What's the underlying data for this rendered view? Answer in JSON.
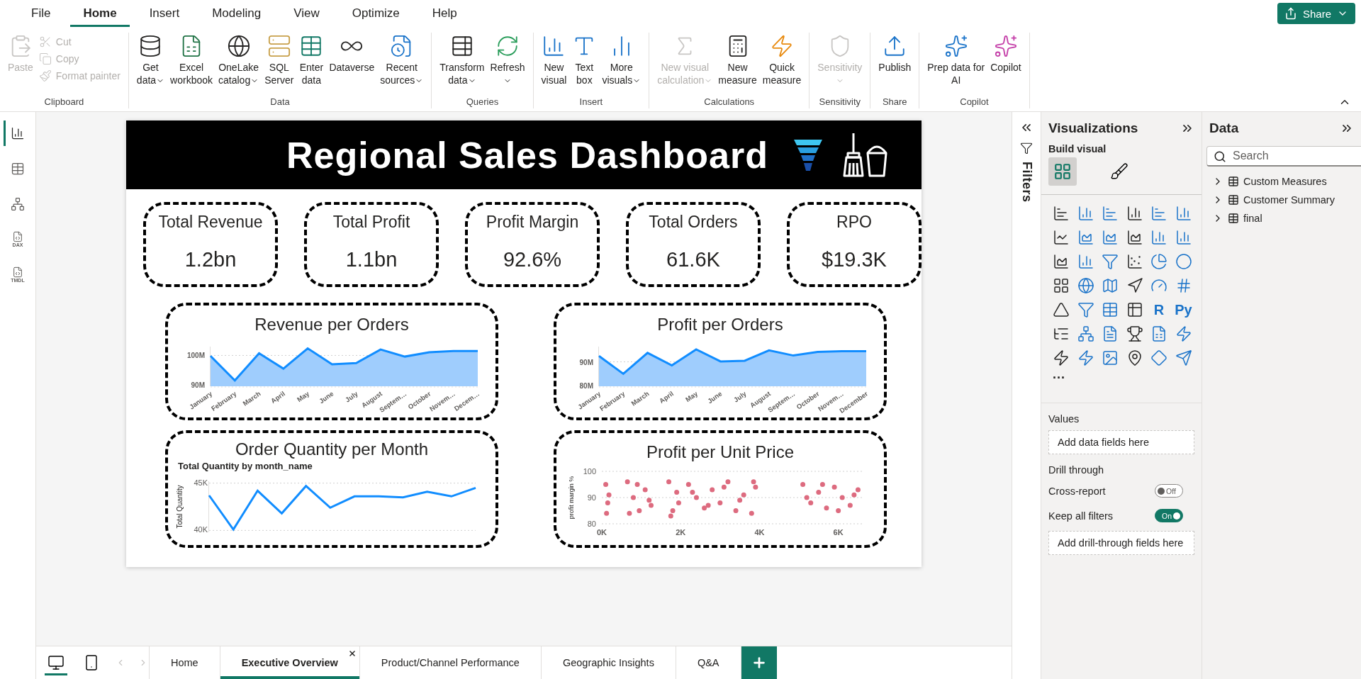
{
  "menu": [
    {
      "label": "File",
      "selected": false
    },
    {
      "label": "Home",
      "selected": true
    },
    {
      "label": "Insert",
      "selected": false
    },
    {
      "label": "Modeling",
      "selected": false
    },
    {
      "label": "View",
      "selected": false
    },
    {
      "label": "Optimize",
      "selected": false
    },
    {
      "label": "Help",
      "selected": false
    }
  ],
  "share_button": {
    "label": "Share"
  },
  "ribbon": [
    {
      "group": "Clipboard",
      "buttons": [
        {
          "label": "Paste",
          "kind": "large",
          "disabled": true,
          "dropdown": false
        },
        {
          "label": "Cut",
          "kind": "small",
          "disabled": true,
          "dropdown": false
        },
        {
          "label": "Copy",
          "kind": "small",
          "disabled": true,
          "dropdown": false
        },
        {
          "label": "Format painter",
          "kind": "small",
          "disabled": true,
          "dropdown": false
        }
      ]
    },
    {
      "group": "Data",
      "buttons": [
        {
          "label": "Get\ndata",
          "kind": "large",
          "disabled": false,
          "dropdown": true
        },
        {
          "label": "Excel\nworkbook",
          "kind": "large",
          "disabled": false,
          "dropdown": false
        },
        {
          "label": "OneLake\ncatalog",
          "kind": "large",
          "disabled": false,
          "dropdown": true
        },
        {
          "label": "SQL\nServer",
          "kind": "large",
          "disabled": false,
          "dropdown": false
        },
        {
          "label": "Enter\ndata",
          "kind": "large",
          "disabled": false,
          "dropdown": false
        },
        {
          "label": "Dataverse",
          "kind": "large",
          "disabled": false,
          "dropdown": false
        },
        {
          "label": "Recent\nsources",
          "kind": "large",
          "disabled": false,
          "dropdown": true
        }
      ]
    },
    {
      "group": "Queries",
      "buttons": [
        {
          "label": "Transform\ndata",
          "kind": "large",
          "disabled": false,
          "dropdown": true
        },
        {
          "label": "Refresh",
          "kind": "large",
          "disabled": false,
          "dropdown": true
        }
      ]
    },
    {
      "group": "Insert",
      "buttons": [
        {
          "label": "New\nvisual",
          "kind": "large",
          "disabled": false,
          "dropdown": false
        },
        {
          "label": "Text\nbox",
          "kind": "large",
          "disabled": false,
          "dropdown": false
        },
        {
          "label": "More\nvisuals",
          "kind": "large",
          "disabled": false,
          "dropdown": true
        }
      ]
    },
    {
      "group": "Calculations",
      "buttons": [
        {
          "label": "New visual\ncalculation",
          "kind": "large",
          "disabled": true,
          "dropdown": true
        },
        {
          "label": "New\nmeasure",
          "kind": "large",
          "disabled": false,
          "dropdown": false
        },
        {
          "label": "Quick\nmeasure",
          "kind": "large",
          "disabled": false,
          "dropdown": false
        }
      ]
    },
    {
      "group": "Sensitivity",
      "buttons": [
        {
          "label": "Sensitivity",
          "kind": "large",
          "disabled": true,
          "dropdown": true
        }
      ]
    },
    {
      "group": "Share",
      "buttons": [
        {
          "label": "Publish",
          "kind": "large",
          "disabled": false,
          "dropdown": false
        }
      ]
    },
    {
      "group": "Copilot",
      "buttons": [
        {
          "label": "Prep data for\nAI",
          "kind": "large",
          "disabled": false,
          "dropdown": false
        },
        {
          "label": "Copilot",
          "kind": "large",
          "disabled": false,
          "dropdown": false
        }
      ]
    }
  ],
  "rail": [
    {
      "selected": true
    },
    {
      "selected": false
    },
    {
      "selected": false
    },
    {
      "label": "DAX",
      "selected": false
    },
    {
      "label": "TMDL",
      "selected": false
    }
  ],
  "report": {
    "title": "Regional Sales Dashboard",
    "kpis": [
      {
        "label": "Total Revenue",
        "value": "1.2bn"
      },
      {
        "label": "Total Profit",
        "value": "1.1bn"
      },
      {
        "label": "Profit Margin",
        "value": "92.6%"
      },
      {
        "label": "Total Orders",
        "value": "61.6K"
      },
      {
        "label": "RPO",
        "value": "$19.3K"
      }
    ],
    "charts": [
      {
        "title": "Revenue per Orders",
        "chart_data": {
          "type": "area",
          "categories": [
            "January",
            "February",
            "March",
            "April",
            "May",
            "June",
            "July",
            "August",
            "Septem…",
            "October",
            "Novem…",
            "Decem…"
          ],
          "series": [
            {
              "color": "#118dff",
              "values": [
                99.8,
                91.5,
                100.7,
                95.5,
                102.4,
                97.0,
                97.4,
                102.0,
                99.6,
                101.1,
                101.5,
                101.5
              ]
            }
          ],
          "ylim": [
            89.5,
            103
          ],
          "yticks": [
            {
              "value": 90,
              "label": "90M"
            },
            {
              "value": 100,
              "label": "100M"
            }
          ]
        }
      },
      {
        "title": "Profit per Orders",
        "chart_data": {
          "type": "area",
          "categories": [
            "January",
            "February",
            "March",
            "April",
            "May",
            "June",
            "July",
            "August",
            "Septem…",
            "October",
            "Novem…",
            "December"
          ],
          "series": [
            {
              "color": "#118dff",
              "values": [
                92.5,
                84.9,
                93.8,
                88.5,
                95.3,
                90.2,
                90.5,
                94.9,
                92.7,
                94.2,
                94.5,
                94.5
              ]
            }
          ],
          "ylim": [
            79.6,
            96.5
          ],
          "yticks": [
            {
              "value": 80,
              "label": "80M"
            },
            {
              "value": 90,
              "label": "90M"
            }
          ]
        }
      },
      {
        "title": "Order Quantity per Month",
        "chart_data": {
          "type": "line",
          "title": "Total Quantity by month_name",
          "ylabel": "Total Quantity",
          "series": [
            {
              "color": "#118dff",
              "values": [
                43.7,
                40.1,
                44.2,
                41.8,
                44.7,
                42.4,
                43.6,
                43.6,
                43.5,
                44.1,
                43.6,
                44.5
              ]
            }
          ],
          "ylim": [
            39.8,
            45.2
          ],
          "yticks": [
            {
              "value": 40,
              "label": "40K"
            },
            {
              "value": 45,
              "label": "45K"
            }
          ]
        }
      },
      {
        "title": "Profit per Unit Price",
        "chart_data": {
          "type": "scatter",
          "ylabel": "profit margin %",
          "x": [
            0.1,
            0.15,
            0.12,
            0.18,
            0.65,
            0.8,
            0.95,
            1.1,
            1.25,
            0.7,
            0.9,
            1.2,
            1.7,
            1.8,
            1.9,
            1.95,
            1.75,
            2.2,
            2.4,
            2.6,
            2.8,
            3.0,
            3.2,
            3.4,
            3.6,
            3.8,
            3.9,
            2.3,
            2.7,
            3.1,
            3.5,
            3.85,
            5.1,
            5.3,
            5.5,
            5.7,
            5.9,
            6.1,
            6.3,
            6.5,
            5.2,
            5.6,
            6.0,
            6.4
          ],
          "series": [
            {
              "color": "#dd6b7f",
              "values": [
                95,
                88,
                84,
                91,
                96,
                90,
                85,
                93,
                87,
                84,
                95,
                89,
                96,
                85,
                92,
                88,
                83,
                95,
                90,
                86,
                93,
                88,
                96,
                85,
                91,
                84,
                94,
                92,
                87,
                94,
                89,
                96,
                95,
                88,
                92,
                86,
                94,
                90,
                87,
                93,
                90,
                95,
                85,
                91
              ]
            }
          ],
          "xlim": [
            0,
            6.6
          ],
          "ylim": [
            80,
            100
          ],
          "xticks": [
            {
              "value": 0,
              "label": "0K"
            },
            {
              "value": 2,
              "label": "2K"
            },
            {
              "value": 4,
              "label": "4K"
            },
            {
              "value": 6,
              "label": "6K"
            }
          ],
          "yticks": [
            80,
            90,
            100
          ]
        }
      }
    ]
  },
  "page_tabs": {
    "views": [
      {
        "selected": true
      },
      {
        "selected": false
      }
    ],
    "tabs": [
      {
        "label": "Home",
        "selected": false
      },
      {
        "label": "Executive Overview",
        "selected": true
      },
      {
        "label": "Product/Channel Performance",
        "selected": false
      },
      {
        "label": "Geographic Insights",
        "selected": false
      },
      {
        "label": "Q&A",
        "selected": false
      }
    ]
  },
  "filters_pane": {
    "title": "Filters"
  },
  "visualizations": {
    "title": "Visualizations",
    "subtitle": "Build visual",
    "modes": [
      {
        "selected": true
      },
      {
        "selected": false
      }
    ],
    "visuals": [
      {
        "kind": "icon"
      },
      {
        "kind": "icon"
      },
      {
        "kind": "icon"
      },
      {
        "kind": "icon"
      },
      {
        "kind": "icon"
      },
      {
        "kind": "icon"
      },
      {
        "kind": "icon"
      },
      {
        "kind": "icon"
      },
      {
        "kind": "icon"
      },
      {
        "kind": "icon"
      },
      {
        "kind": "icon"
      },
      {
        "kind": "icon"
      },
      {
        "kind": "icon"
      },
      {
        "kind": "icon"
      },
      {
        "kind": "icon"
      },
      {
        "kind": "icon"
      },
      {
        "kind": "icon"
      },
      {
        "kind": "icon"
      },
      {
        "kind": "icon"
      },
      {
        "kind": "icon"
      },
      {
        "kind": "icon"
      },
      {
        "kind": "icon"
      },
      {
        "kind": "icon"
      },
      {
        "kind": "icon"
      },
      {
        "kind": "icon"
      },
      {
        "kind": "icon"
      },
      {
        "kind": "icon"
      },
      {
        "kind": "icon"
      },
      {
        "kind": "text",
        "label": "R"
      },
      {
        "kind": "text",
        "label": "Py"
      },
      {
        "kind": "icon"
      },
      {
        "kind": "icon"
      },
      {
        "kind": "icon"
      },
      {
        "kind": "icon"
      },
      {
        "kind": "icon"
      },
      {
        "kind": "icon"
      },
      {
        "kind": "icon"
      },
      {
        "kind": "icon"
      },
      {
        "kind": "icon"
      },
      {
        "kind": "icon"
      },
      {
        "kind": "icon"
      },
      {
        "kind": "icon"
      }
    ],
    "more": "···",
    "values_label": "Values",
    "values_well": "Add data fields here",
    "drill_title": "Drill through",
    "toggles": [
      {
        "label": "Cross-report",
        "on": false,
        "state": "Off"
      },
      {
        "label": "Keep all filters",
        "on": true,
        "state": "On"
      }
    ],
    "drill_well": "Add drill-through fields here"
  },
  "data_pane": {
    "title": "Data",
    "search": {
      "placeholder": "Search"
    },
    "tables": [
      {
        "name": "Custom Measures",
        "expanded": false
      },
      {
        "name": "Customer Summary",
        "expanded": false
      },
      {
        "name": "final",
        "expanded": false
      }
    ]
  }
}
